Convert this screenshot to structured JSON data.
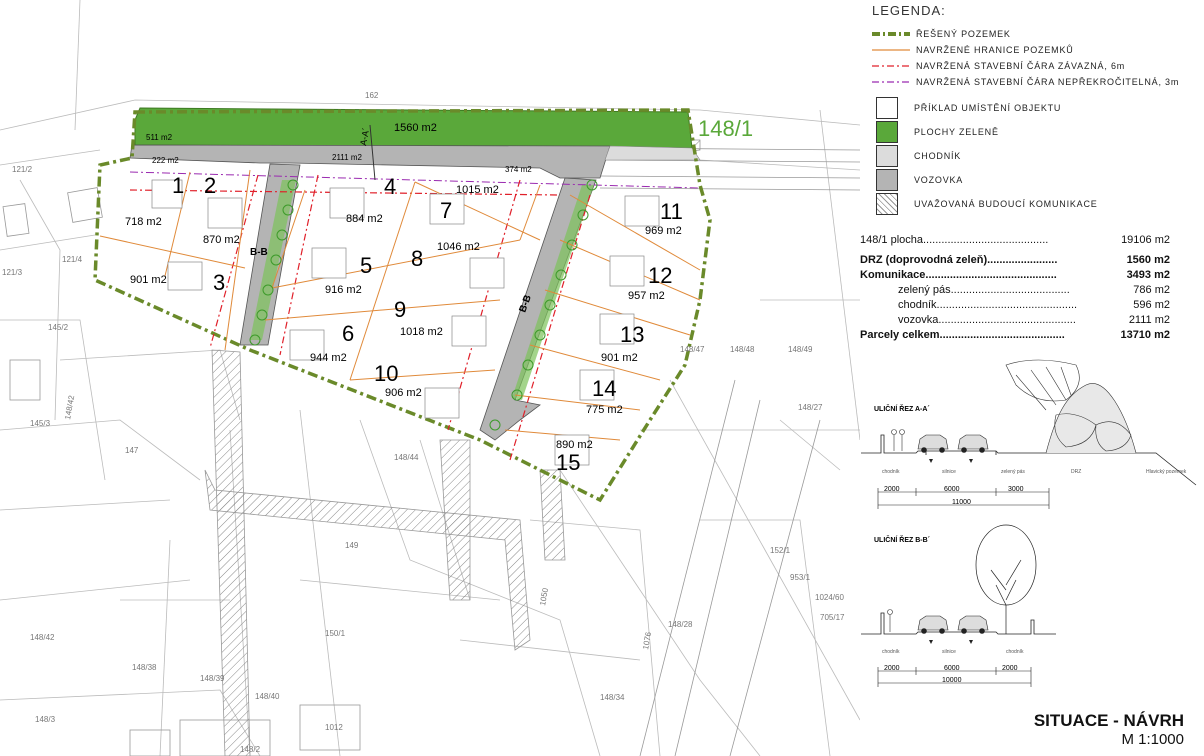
{
  "legend": {
    "title": "LEGENDA:",
    "lines": [
      {
        "label": "ŘEŠENÝ POZEMEK",
        "color": "#6a8a2a",
        "style": "thick-dash"
      },
      {
        "label": "NAVRŽENÉ HRANICE POZEMKŮ",
        "color": "#e08a3a",
        "style": "solid"
      },
      {
        "label": "NAVRŽENÁ STAVEBNÍ ČÁRA ZÁVAZNÁ, 6m",
        "color": "#e0202a",
        "style": "dash-dot"
      },
      {
        "label": "NAVRŽENÁ STAVEBNÍ ČÁRA NEPŘEKROČITELNÁ, 3m",
        "color": "#9a2ab0",
        "style": "dash-dot"
      }
    ],
    "boxes": [
      {
        "label": "PŘÍKLAD UMÍSTĚNÍ OBJEKTU",
        "fill": "#ffffff"
      },
      {
        "label": "PLOCHY ZELENĚ",
        "fill": "#5aa83a"
      },
      {
        "label": "CHODNÍK",
        "fill": "#dcdcdc"
      },
      {
        "label": "VOZOVKA",
        "fill": "#b4b4b4"
      },
      {
        "label": "UVAŽOVANÁ BUDOUCÍ KOMUNIKACE",
        "fill": "hatch"
      }
    ]
  },
  "areas": {
    "plocha": {
      "label": "148/1 plocha.........................................",
      "value": "19106 m2"
    },
    "drz": {
      "label": "DRZ (doprovodná zeleň).......................",
      "value": "1560 m2"
    },
    "komunikace": {
      "label": "Komunikace...........................................",
      "value": "3493 m2"
    },
    "zeleny": {
      "label": "zelený pás.......................................",
      "value": "786 m2"
    },
    "chodnik": {
      "label": "chodník..............................................",
      "value": "596 m2"
    },
    "vozovka": {
      "label": "vozovka.............................................",
      "value": "2111 m2"
    },
    "parcely": {
      "label": "Parcely celkem.........................................",
      "value": "13710 m2"
    }
  },
  "sections": {
    "aa": {
      "title": "ULIČNÍ ŘEZ A-A´",
      "dims": [
        "2000",
        "6000",
        "3000"
      ],
      "total": "11000",
      "labels": [
        "chodník",
        "silnice",
        "zelený pás",
        "DRZ",
        "Hlavický pozemek"
      ]
    },
    "bb": {
      "title": "ULIČNÍ ŘEZ B-B´",
      "dims": [
        "2000",
        "6000",
        "2000"
      ],
      "total": "10000",
      "labels": [
        "chodník",
        "silnice",
        "chodník"
      ]
    }
  },
  "title_block": {
    "title": "SITUACE - NÁVRH",
    "scale": "M 1:1000"
  },
  "plan": {
    "green_area": "1560 m2",
    "parcel_label": "148/1",
    "strip_areas": [
      "511 m2",
      "222 m2",
      "2111 m2",
      "374 m2",
      "1015 m2"
    ],
    "section_marks": [
      "A-A´",
      "B-B",
      "B-B"
    ],
    "lots": [
      {
        "num": "1",
        "area": "718 m2"
      },
      {
        "num": "2",
        "area": "870 m2"
      },
      {
        "num": "3",
        "area": "901 m2"
      },
      {
        "num": "4",
        "area": "884 m2"
      },
      {
        "num": "5",
        "area": "916 m2"
      },
      {
        "num": "6",
        "area": "944 m2"
      },
      {
        "num": "7",
        "area": "1046 m2"
      },
      {
        "num": "8",
        "area": "1046 m2"
      },
      {
        "num": "9",
        "area": "1018 m2"
      },
      {
        "num": "10",
        "area": "906 m2"
      },
      {
        "num": "11",
        "area": "969 m2"
      },
      {
        "num": "12",
        "area": "957 m2"
      },
      {
        "num": "13",
        "area": "901 m2"
      },
      {
        "num": "14",
        "area": "775 m2"
      },
      {
        "num": "15",
        "area": "890 m2"
      }
    ],
    "cadastral": [
      "162",
      "121/2",
      "121/3",
      "121/4",
      "145/2",
      "145/3",
      "148/42",
      "147",
      "148/44",
      "149",
      "150/1",
      "148/39",
      "148/40",
      "148/3",
      "148/2",
      "148/28",
      "148/47",
      "148/48",
      "148/49",
      "148/27",
      "1024/60",
      "953/1",
      "152/1",
      "148/38",
      "148/42",
      "1012",
      "705/17",
      "148/34",
      "1050",
      "1076"
    ]
  }
}
